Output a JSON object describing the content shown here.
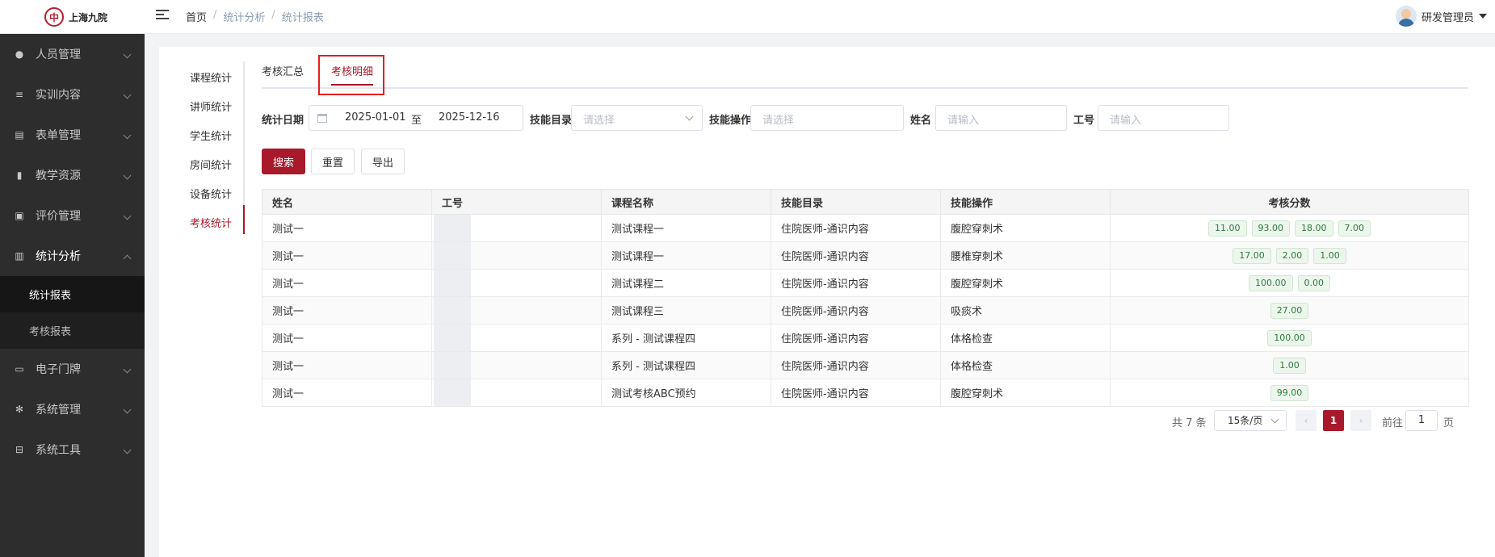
{
  "header": {
    "logo_text": "上海九院",
    "breadcrumb": [
      "首页",
      "统计分析",
      "统计报表"
    ],
    "user_name": "研发管理员"
  },
  "sidebar": {
    "items": [
      {
        "label": "人员管理",
        "icon": "person-icon"
      },
      {
        "label": "实训内容",
        "icon": "list-icon"
      },
      {
        "label": "表单管理",
        "icon": "form-icon"
      },
      {
        "label": "教学资源",
        "icon": "book-icon"
      },
      {
        "label": "评价管理",
        "icon": "rating-icon"
      },
      {
        "label": "统计分析",
        "icon": "bar-chart-icon"
      },
      {
        "label": "电子门牌",
        "icon": "monitor-icon"
      },
      {
        "label": "系统管理",
        "icon": "gear-icon"
      },
      {
        "label": "系统工具",
        "icon": "toolbox-icon"
      }
    ],
    "sub_items": [
      "统计报表",
      "考核报表"
    ]
  },
  "subnav": [
    "课程统计",
    "讲师统计",
    "学生统计",
    "房间统计",
    "设备统计",
    "考核统计"
  ],
  "tabs": [
    "考核汇总",
    "考核明细"
  ],
  "filters": {
    "date_label": "统计日期",
    "date_start": "2025-01-01",
    "date_to": "至",
    "date_end": "2025-12-16",
    "skill_dir_label": "技能目录",
    "skill_dir_placeholder": "请选择",
    "skill_op_label": "技能操作",
    "skill_op_placeholder": "请选择",
    "name_label": "姓名",
    "name_placeholder": "请输入",
    "id_label": "工号",
    "id_placeholder": "请输入"
  },
  "buttons": {
    "search": "搜索",
    "reset": "重置",
    "export": "导出"
  },
  "table": {
    "columns": [
      "姓名",
      "工号",
      "课程名称",
      "技能目录",
      "技能操作",
      "考核分数"
    ],
    "rows": [
      {
        "name": "测试一",
        "course": "测试课程一",
        "dir": "住院医师-通识内容",
        "op": "腹腔穿刺术",
        "scores": [
          "11.00",
          "93.00",
          "18.00",
          "7.00"
        ]
      },
      {
        "name": "测试一",
        "course": "测试课程一",
        "dir": "住院医师-通识内容",
        "op": "腰椎穿刺术",
        "scores": [
          "17.00",
          "2.00",
          "1.00"
        ]
      },
      {
        "name": "测试一",
        "course": "测试课程二",
        "dir": "住院医师-通识内容",
        "op": "腹腔穿刺术",
        "scores": [
          "100.00",
          "0.00"
        ]
      },
      {
        "name": "测试一",
        "course": "测试课程三",
        "dir": "住院医师-通识内容",
        "op": "吸痰术",
        "scores": [
          "27.00"
        ]
      },
      {
        "name": "测试一",
        "course": "系列 - 测试课程四",
        "dir": "住院医师-通识内容",
        "op": "体格检查",
        "scores": [
          "100.00"
        ]
      },
      {
        "name": "测试一",
        "course": "系列 - 测试课程四",
        "dir": "住院医师-通识内容",
        "op": "体格检查",
        "scores": [
          "1.00"
        ]
      },
      {
        "name": "测试一",
        "course": "测试考核ABC预约",
        "dir": "住院医师-通识内容",
        "op": "腹腔穿刺术",
        "scores": [
          "99.00"
        ]
      }
    ]
  },
  "pagination": {
    "total": "共 7 条",
    "page_size": "15条/页",
    "prev": "‹",
    "current": "1",
    "next": "›",
    "goto_label": "前往",
    "goto_value": "1",
    "goto_unit": "页"
  },
  "colors": {
    "accent": "#a8192b",
    "sidebar_bg": "#2d2d2d",
    "score_green": "#2d7a3b"
  }
}
